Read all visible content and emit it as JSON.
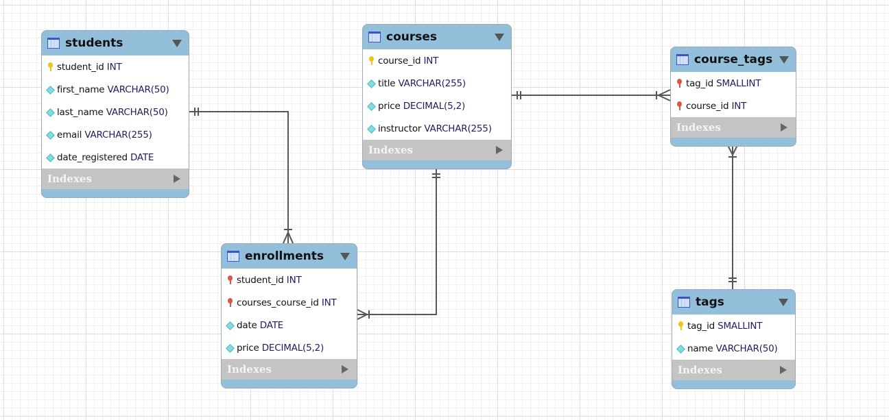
{
  "tables": [
    {
      "id": "students",
      "name": "students",
      "columns": [
        {
          "kind": "pk",
          "name": "student_id",
          "type": "INT"
        },
        {
          "kind": "col",
          "name": "first_name",
          "type": "VARCHAR(50)"
        },
        {
          "kind": "col",
          "name": "last_name",
          "type": "VARCHAR(50)"
        },
        {
          "kind": "col",
          "name": "email",
          "type": "VARCHAR(255)"
        },
        {
          "kind": "col",
          "name": "date_registered",
          "type": "DATE"
        }
      ],
      "indexes_label": "Indexes"
    },
    {
      "id": "courses",
      "name": "courses",
      "columns": [
        {
          "kind": "pk",
          "name": "course_id",
          "type": "INT"
        },
        {
          "kind": "col",
          "name": "title",
          "type": "VARCHAR(255)"
        },
        {
          "kind": "col",
          "name": "price",
          "type": "DECIMAL(5,2)"
        },
        {
          "kind": "col",
          "name": "instructor",
          "type": "VARCHAR(255)"
        }
      ],
      "indexes_label": "Indexes"
    },
    {
      "id": "course_tags",
      "name": "course_tags",
      "columns": [
        {
          "kind": "fk",
          "name": "tag_id",
          "type": "SMALLINT"
        },
        {
          "kind": "fk",
          "name": "course_id",
          "type": "INT"
        }
      ],
      "indexes_label": "Indexes"
    },
    {
      "id": "enrollments",
      "name": "enrollments",
      "columns": [
        {
          "kind": "fk",
          "name": "student_id",
          "type": "INT"
        },
        {
          "kind": "fk",
          "name": "courses_course_id",
          "type": "INT"
        },
        {
          "kind": "col",
          "name": "date",
          "type": "DATE"
        },
        {
          "kind": "col",
          "name": "price",
          "type": "DECIMAL(5,2)"
        }
      ],
      "indexes_label": "Indexes"
    },
    {
      "id": "tags",
      "name": "tags",
      "columns": [
        {
          "kind": "pk",
          "name": "tag_id",
          "type": "SMALLINT"
        },
        {
          "kind": "col",
          "name": "name",
          "type": "VARCHAR(50)"
        }
      ],
      "indexes_label": "Indexes"
    }
  ],
  "relationships": [
    {
      "from": "students",
      "to": "enrollments",
      "cardinality": "one-to-many"
    },
    {
      "from": "courses",
      "to": "enrollments",
      "cardinality": "one-to-many"
    },
    {
      "from": "courses",
      "to": "course_tags",
      "cardinality": "one-to-many"
    },
    {
      "from": "tags",
      "to": "course_tags",
      "cardinality": "one-to-many"
    }
  ],
  "colors": {
    "header": "#93bfdb",
    "indexes": "#c4c4c4",
    "primary_key": "#f0c419",
    "foreign_key": "#d8574a",
    "column": "#7fdde0",
    "line": "#555555"
  }
}
